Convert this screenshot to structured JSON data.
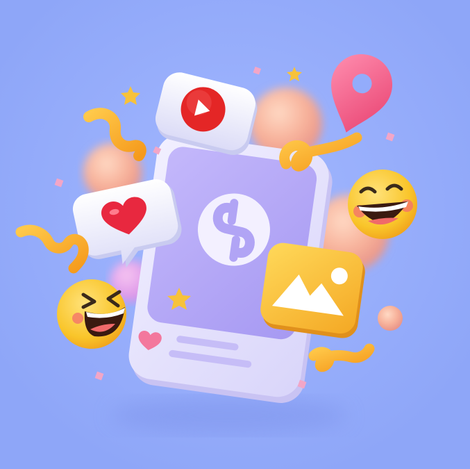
{
  "scene": {
    "description_free": true,
    "colors": {
      "background": "#93acfb",
      "phone_body": "#e4e2fb",
      "phone_screen": "#b4a8f7",
      "accent_purple": "#a898f0",
      "emoji_yellow": "#f9c52a",
      "emoji_orange": "#f5a623",
      "heart_red": "#e8283f",
      "play_red": "#e42626",
      "pin_pink": "#f25b8b",
      "peach": "#f7b69a",
      "star_gold": "#f7c23a"
    },
    "icons": [
      "play-button-icon",
      "heart-icon",
      "map-pin-icon",
      "laughing-emoji-icon",
      "grinning-emoji-icon",
      "image-picture-icon",
      "app-logo-icon",
      "small-heart-icon",
      "star-icon"
    ]
  }
}
